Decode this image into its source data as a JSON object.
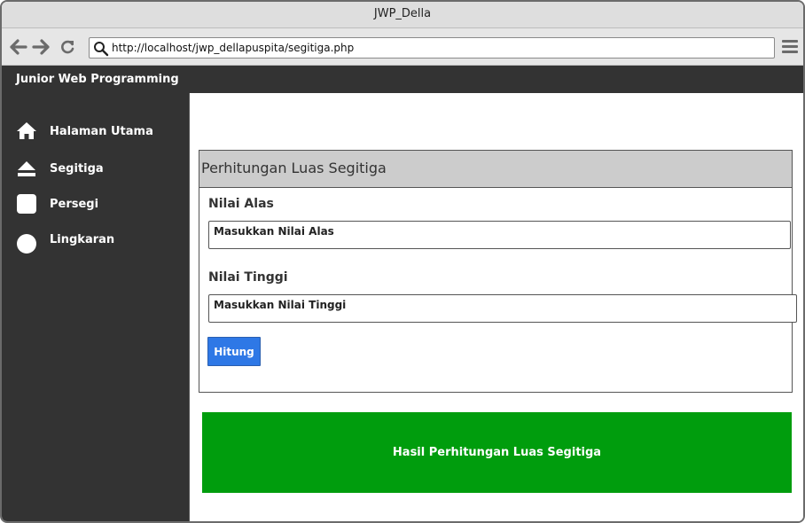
{
  "window": {
    "title": "JWP_Della"
  },
  "browser": {
    "url": "http://localhost/jwp_dellapuspita/segitiga.php",
    "icons": {
      "back": "arrow-left-icon",
      "forward": "arrow-right-icon",
      "reload": "reload-icon",
      "search": "search-icon",
      "menu": "hamburger-menu-icon"
    }
  },
  "header": {
    "title": "Junior Web Programming"
  },
  "sidebar": {
    "items": [
      {
        "label": "Halaman Utama",
        "icon": "home-icon"
      },
      {
        "label": "Segitiga",
        "icon": "eject-triangle-icon"
      },
      {
        "label": "Persegi",
        "icon": "square-icon"
      },
      {
        "label": "Lingkaran",
        "icon": "circle-icon"
      }
    ]
  },
  "form": {
    "title": "Perhitungan Luas Segitiga",
    "alas": {
      "label": "Nilai Alas",
      "placeholder": "Masukkan Nilai Alas"
    },
    "tinggi": {
      "label": "Nilai Tinggi",
      "placeholder": "Masukkan Nilai Tinggi"
    },
    "submit_label": "Hitung"
  },
  "result": {
    "text": "Hasil Perhitungan Luas Segitiga"
  },
  "colors": {
    "header_bg": "#333333",
    "button_blue": "#2e78e6",
    "result_green": "#009d0d",
    "panel_head_bg": "#cccccc"
  }
}
